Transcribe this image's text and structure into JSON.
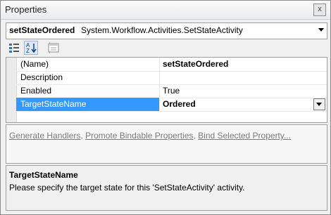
{
  "window": {
    "title": "Properties",
    "close_label": "x"
  },
  "selector": {
    "name": "setStateOrdered",
    "type": "System.Workflow.Activities.SetStateActivity"
  },
  "toolbar": {
    "buttons": [
      {
        "icon": "categorized-icon"
      },
      {
        "icon": "alphabetical-icon"
      },
      {
        "icon": "property-pages-icon"
      }
    ]
  },
  "properties": [
    {
      "name": "(Name)",
      "value": "setStateOrdered",
      "bold": true
    },
    {
      "name": "Description",
      "value": ""
    },
    {
      "name": "Enabled",
      "value": "True"
    },
    {
      "name": "TargetStateName",
      "value": "Ordered",
      "selected": true
    }
  ],
  "commands": {
    "links": [
      "Generate Handlers",
      "Promote Bindable Properties",
      "Bind Selected Property..."
    ],
    "separator": ", "
  },
  "description": {
    "title": "TargetStateName",
    "text": "Please specify the target state for this 'SetStateActivity' activity."
  },
  "colors": {
    "selection": "#3399ff",
    "disabled_text": "#7a7a7a"
  }
}
